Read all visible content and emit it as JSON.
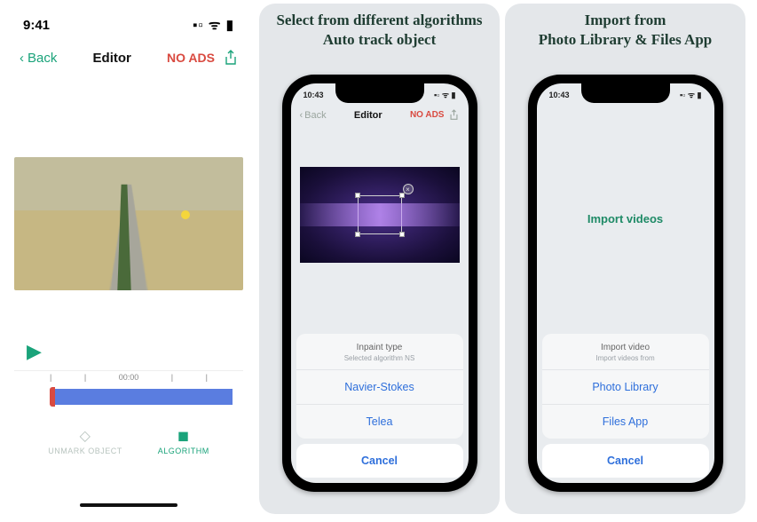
{
  "panel1": {
    "status_time": "9:41",
    "status_icons": "▪▫ ᯤ ▮",
    "back_label": "Back",
    "title": "Editor",
    "no_ads": "NO ADS",
    "tracker_dot": "●",
    "timeline_center_label": "00:00",
    "tool_unmark": "UNMARK OBJECT",
    "tool_algorithm": "ALGORITHM"
  },
  "panel2": {
    "caption_line1": "Select from different algorithms",
    "caption_line2": "Auto track object",
    "status_time": "10:43",
    "status_icons": "▪▫ ᯤ ▮",
    "back_label": "Back",
    "title": "Editor",
    "no_ads": "NO ADS",
    "sheet_title": "Inpaint type",
    "sheet_subtitle": "Selected algorithm NS",
    "option1": "Navier-Stokes",
    "option2": "Telea",
    "cancel": "Cancel"
  },
  "panel3": {
    "caption_line1": "Import from",
    "caption_line2": "Photo Library & Files App",
    "status_time": "10:43",
    "status_icons": "▪▫ ᯤ ▮",
    "import_label": "Import videos",
    "sheet_title": "Import video",
    "sheet_subtitle": "Import videos from",
    "option1": "Photo Library",
    "option2": "Files App",
    "cancel": "Cancel"
  }
}
